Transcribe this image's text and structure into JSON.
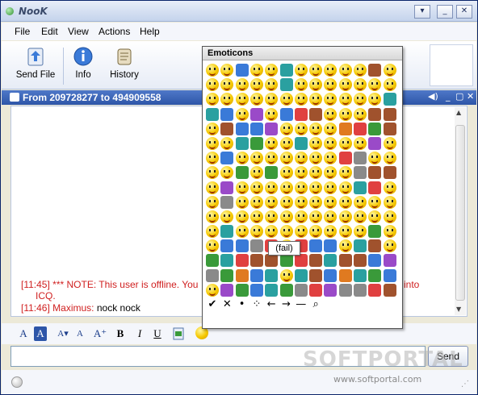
{
  "window": {
    "title": "NooK"
  },
  "menu": [
    "File",
    "Edit",
    "View",
    "Actions",
    "Help"
  ],
  "toolbar": {
    "send_file": "Send File",
    "info": "Info",
    "history": "History"
  },
  "chat": {
    "header": "From 209728277 to 494909558",
    "messages": [
      {
        "time": "[11:45]",
        "text": "*** NOTE: This user is offline.  You",
        "tail": "gs into",
        "cont": "ICQ."
      },
      {
        "time": "[11:46]",
        "name": "Maximus:",
        "text": "nock nock"
      }
    ]
  },
  "format_bar": [
    "A",
    "A",
    "A▾",
    "A",
    "A⁺",
    "B",
    "I",
    "U"
  ],
  "send_button": "Send",
  "emoticons": {
    "title": "Emoticons",
    "tooltip": "(fail)",
    "bottom_symbols": [
      "✔",
      "✕",
      "•",
      "⁘",
      "←",
      "→",
      "—",
      "⌕"
    ]
  },
  "watermark": {
    "brand": "SOFTPORTAL",
    "url": "www.softportal.com"
  },
  "colors": {
    "accent": "#2d55a8",
    "offline_note": "#d02020"
  }
}
